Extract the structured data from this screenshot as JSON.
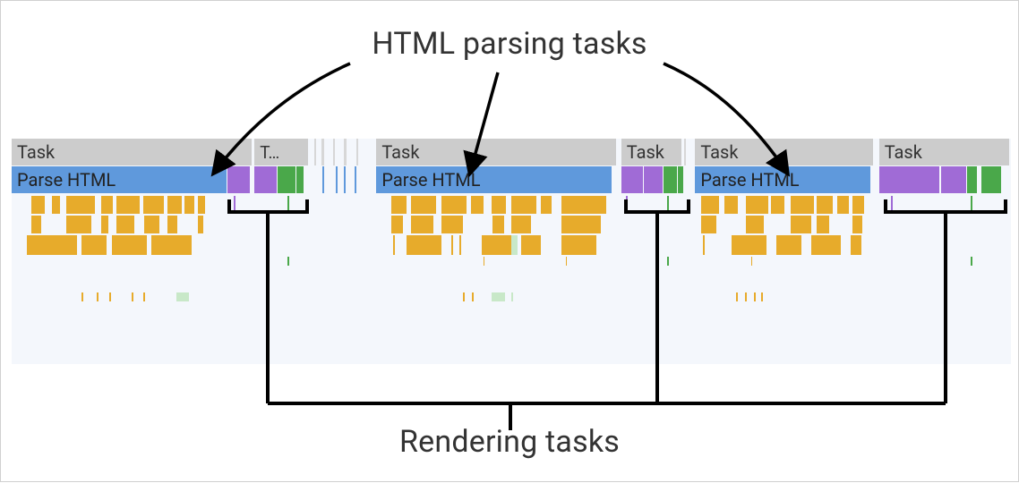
{
  "labels": {
    "top": "HTML parsing tasks",
    "bottom": "Rendering tasks"
  },
  "task_label": "Task",
  "task_label_truncated": "T…",
  "parse_label": "Parse HTML",
  "colors": {
    "task_bg": "#ccc",
    "parse_bg": "#5f99dc",
    "purple": "#a06bd6",
    "green": "#4aa84a",
    "yellow": "#e7ab2b",
    "timeline_bg": "#f4f7fc"
  },
  "chart_data": {
    "type": "timeline",
    "description": "Chrome DevTools performance flame-chart excerpt showing three large 'Parse HTML' tasks (blue), each inside a grey 'Task' wrapper, separated by short purple+green rendering tasks; below are several rows of yellow sub-task bars.",
    "tracks": {
      "task_row": [
        {
          "label": "Task",
          "left_pct": 0.0,
          "width_pct": 24.0
        },
        {
          "label": "T…",
          "left_pct": 24.3,
          "width_pct": 5.4
        },
        {
          "label": "Task",
          "left_pct": 36.5,
          "width_pct": 24.0
        },
        {
          "label": "Task",
          "left_pct": 61.0,
          "width_pct": 6.0
        },
        {
          "label": "Task",
          "left_pct": 68.4,
          "width_pct": 17.8
        },
        {
          "label": "Task",
          "left_pct": 86.8,
          "width_pct": 13.0
        }
      ],
      "parse_row": [
        {
          "label": "Parse HTML",
          "left_pct": 0.0,
          "width_pct": 21.5,
          "kind": "parse"
        },
        {
          "left_pct": 21.6,
          "width_pct": 2.2,
          "kind": "purple"
        },
        {
          "left_pct": 24.3,
          "width_pct": 2.2,
          "kind": "purple"
        },
        {
          "left_pct": 26.6,
          "width_pct": 1.8,
          "kind": "green"
        },
        {
          "left_pct": 28.5,
          "width_pct": 0.7,
          "kind": "green"
        },
        {
          "label": "Parse HTML",
          "left_pct": 36.5,
          "width_pct": 23.5,
          "kind": "parse"
        },
        {
          "left_pct": 61.0,
          "width_pct": 2.2,
          "kind": "purple"
        },
        {
          "left_pct": 63.3,
          "width_pct": 1.8,
          "kind": "purple"
        },
        {
          "left_pct": 65.2,
          "width_pct": 1.4,
          "kind": "green"
        },
        {
          "left_pct": 66.7,
          "width_pct": 0.5,
          "kind": "green"
        },
        {
          "label": "Parse HTML",
          "left_pct": 68.4,
          "width_pct": 17.5,
          "kind": "parse"
        },
        {
          "left_pct": 86.8,
          "width_pct": 6.0,
          "kind": "purple"
        },
        {
          "left_pct": 93.0,
          "width_pct": 2.5,
          "kind": "purple"
        },
        {
          "left_pct": 95.6,
          "width_pct": 1.0,
          "kind": "green"
        },
        {
          "left_pct": 97.0,
          "width_pct": 2.0,
          "kind": "green"
        }
      ]
    }
  }
}
